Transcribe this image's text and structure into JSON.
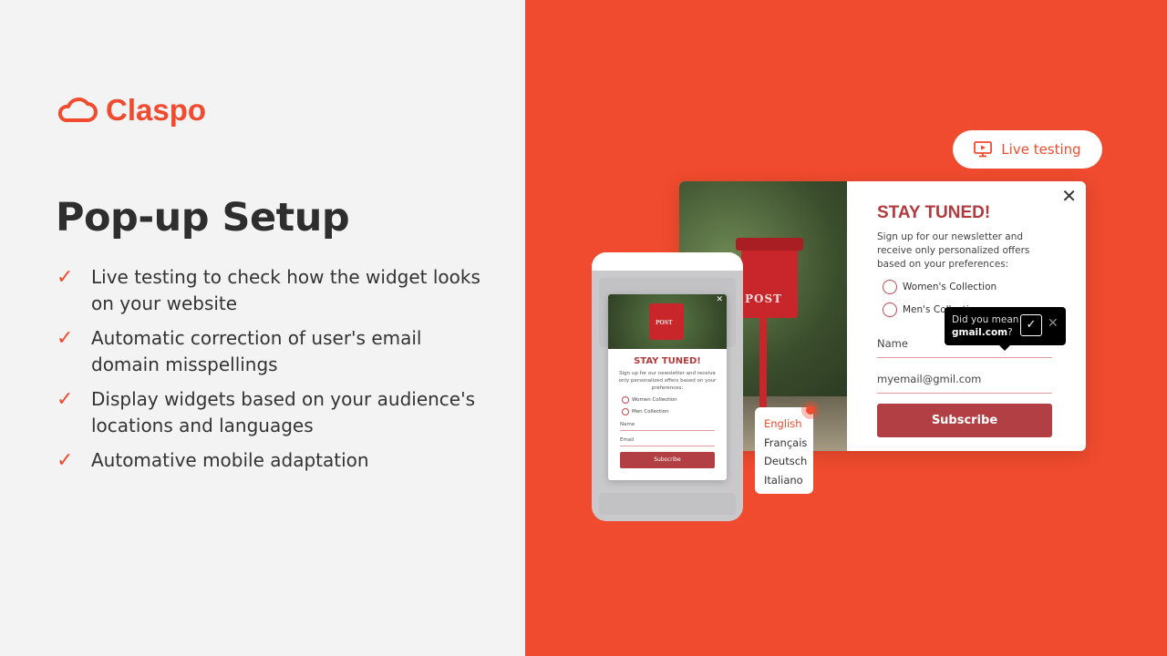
{
  "brand": {
    "name": "Claspo",
    "accent": "#f04b2e"
  },
  "headline": "Pop-up Setup",
  "features": [
    "Live testing to check how the widget looks on your website",
    "Automatic correction of user's email domain misspellings",
    "Display widgets based on your audience's locations and languages",
    "Automative mobile adaptation"
  ],
  "live_testing": {
    "label": "Live testing",
    "icon": "monitor-play-icon"
  },
  "desktop_popup": {
    "title": "STAY TUNED!",
    "description": "Sign up for our newsletter and receive only personalized offers based on your preferences:",
    "options": [
      "Women's Collection",
      "Men's Collection"
    ],
    "name_placeholder": "Name",
    "email_value": "myemail@gmil.com",
    "subscribe": "Subscribe",
    "photo_sign": "POST"
  },
  "suggestion": {
    "prefix": "Did you mean",
    "domain": "gmail.com",
    "suffix": "?"
  },
  "mobile_popup": {
    "title": "STAY TUNED!",
    "description": "Sign up for our newsletter and receive only personalized offers based on your preferences:",
    "options": [
      "Women Collection",
      "Men Collection"
    ],
    "name_placeholder": "Name",
    "email_placeholder": "Email",
    "subscribe": "Subscribe",
    "photo_sign": "POST"
  },
  "languages": {
    "items": [
      "English",
      "Français",
      "Deutsch",
      "Italiano"
    ],
    "selected": "English"
  }
}
